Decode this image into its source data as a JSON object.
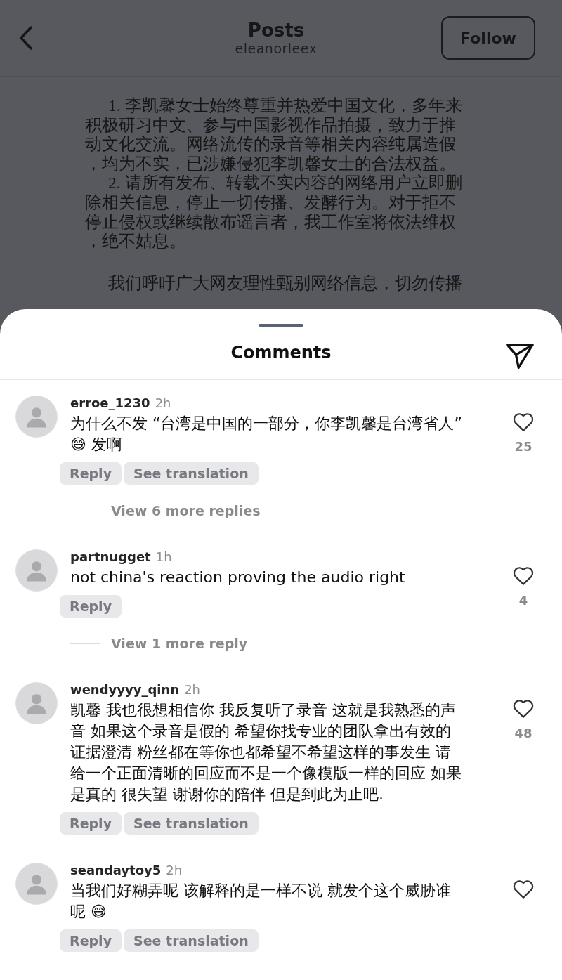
{
  "header": {
    "title": "Posts",
    "subtitle": "eleanorleex",
    "follow_button": "Follow"
  },
  "post": {
    "paragraphs": [
      {
        "number": "1.",
        "text": "李凯馨女士始终尊重并热爱中国文化，多年来积极研习中文、参与中国影视作品拍摄，致力于推动文化交流。网络流传的录音等相关内容纯属造假，均为不实，已涉嫌侵犯李凯馨女士的合法权益。"
      },
      {
        "number": "2.",
        "text": "请所有发布、转载不实内容的网络用户立即删除相关信息，停止一切传播、发酵行为。对于拒不停止侵权或继续散布谣言者，我工作室将依法维权，绝不姑息。"
      },
      {
        "text": "我们呼吁广大网友理性甄别网络信息，切勿传播"
      }
    ]
  },
  "comments_sheet": {
    "title": "Comments",
    "comments": [
      {
        "username": "erroe_1230",
        "time": "2h",
        "text": "为什么不发 “台湾是中国的一部分，你李凯馨是台湾省人” 😅 发啊",
        "likes": "25",
        "actions": [
          "Reply",
          "See translation"
        ],
        "more_replies": "View 6 more replies"
      },
      {
        "username": "partnugget",
        "time": "1h",
        "text": "not china's reaction proving the audio right",
        "likes": "4",
        "actions": [
          "Reply"
        ],
        "more_replies": "View 1 more reply"
      },
      {
        "username": "wendyyyy_qinn",
        "time": "2h",
        "text": "凯馨 我也很想相信你 我反复听了录音 这就是我熟悉的声音 如果这个录音是假的 希望你找专业的团队拿出有效的证据澄清 粉丝都在等你也都希望不希望这样的事发生 请给一个正面清晰的回应而不是一个像模版一样的回应 如果是真的 很失望 谢谢你的陪伴 但是到此为止吧.",
        "likes": "48",
        "actions": [
          "Reply",
          "See translation"
        ]
      },
      {
        "username": "seandaytoy5",
        "time": "2h",
        "text": "当我们好糊弄呢 该解释的是一样不说 就发个这个威胁谁呢 😅",
        "actions": [
          "Reply",
          "See translation"
        ]
      }
    ]
  }
}
